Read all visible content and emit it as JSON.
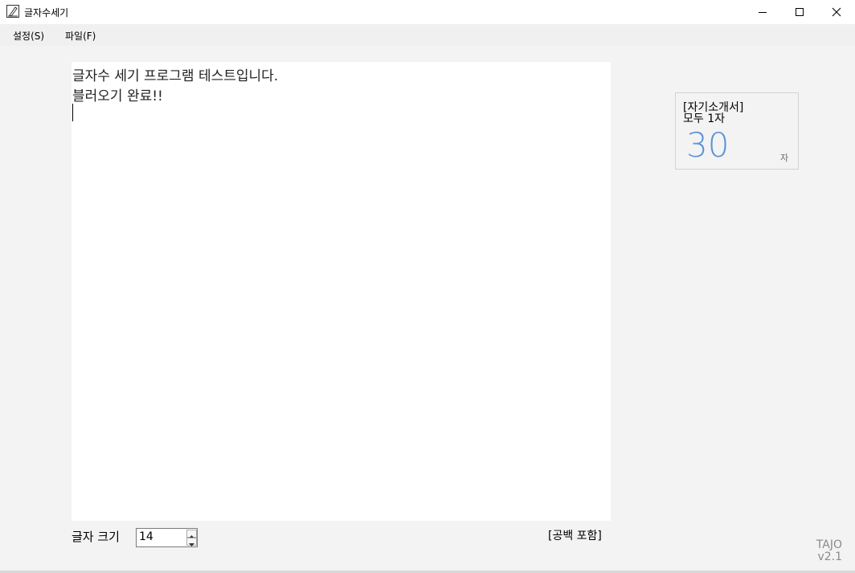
{
  "window": {
    "title": "글자수세기",
    "icon": "app-pen-icon"
  },
  "menu": {
    "settings": "설정(S)",
    "file": "파일(F)"
  },
  "editor": {
    "lines": [
      "글자수 세기 프로그램 테스트입니다.",
      "블러오기 완료!!"
    ]
  },
  "font_size": {
    "label": "글자 크기",
    "value": "14"
  },
  "space_option": "[공백 포함]",
  "counter": {
    "title": "[자기소개서]",
    "subtitle": "모두 1자",
    "value": "30",
    "unit": "자",
    "value_color": "#5b92d8"
  },
  "brand": {
    "name": "TAJO",
    "version": "v2.1"
  }
}
